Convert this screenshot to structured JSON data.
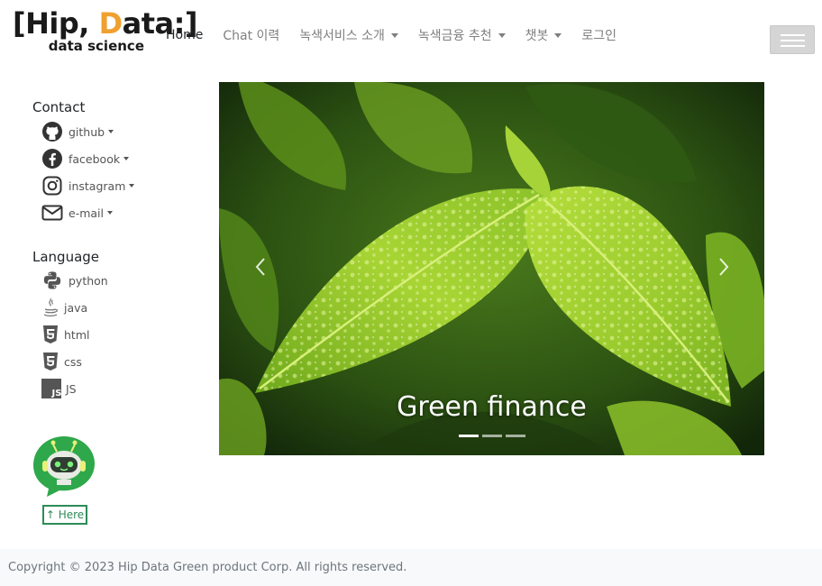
{
  "brand": {
    "name_part1": "[Hip, ",
    "name_accent": "D",
    "name_part2": "ata:]",
    "tagline": "data science"
  },
  "nav": {
    "items": [
      {
        "label": "Home",
        "active": true,
        "dropdown": false
      },
      {
        "label": "Chat 이력",
        "active": false,
        "dropdown": false
      },
      {
        "label": "녹색서비스 소개",
        "active": false,
        "dropdown": true
      },
      {
        "label": "녹색금융 추천",
        "active": false,
        "dropdown": true
      },
      {
        "label": "챗봇",
        "active": false,
        "dropdown": true
      },
      {
        "label": "로그인",
        "active": false,
        "dropdown": false
      }
    ]
  },
  "sidebar": {
    "contact_title": "Contact",
    "contact": [
      {
        "label": "github",
        "icon": "github-icon"
      },
      {
        "label": "facebook",
        "icon": "facebook-icon"
      },
      {
        "label": "instagram",
        "icon": "instagram-icon"
      },
      {
        "label": "e-mail",
        "icon": "envelope-icon"
      }
    ],
    "language_title": "Language",
    "languages": [
      {
        "label": "python",
        "icon": "python-icon"
      },
      {
        "label": "java",
        "icon": "java-icon"
      },
      {
        "label": "html",
        "icon": "html5-icon"
      },
      {
        "label": "css",
        "icon": "css3-icon"
      },
      {
        "label": "JS",
        "icon": "js-icon"
      }
    ],
    "here_button": "↑ Here"
  },
  "carousel": {
    "caption": "Green finance",
    "slides": 3,
    "active_slide": 1
  },
  "footer": {
    "copyright": "Copyright © 2023 Hip Data Green product Corp. All rights reserved."
  },
  "colors": {
    "brand_accent": "#f0a030",
    "bot_green": "#2ea84a",
    "here_green": "#2e8b57",
    "footer_bg": "#f8f9fa"
  }
}
